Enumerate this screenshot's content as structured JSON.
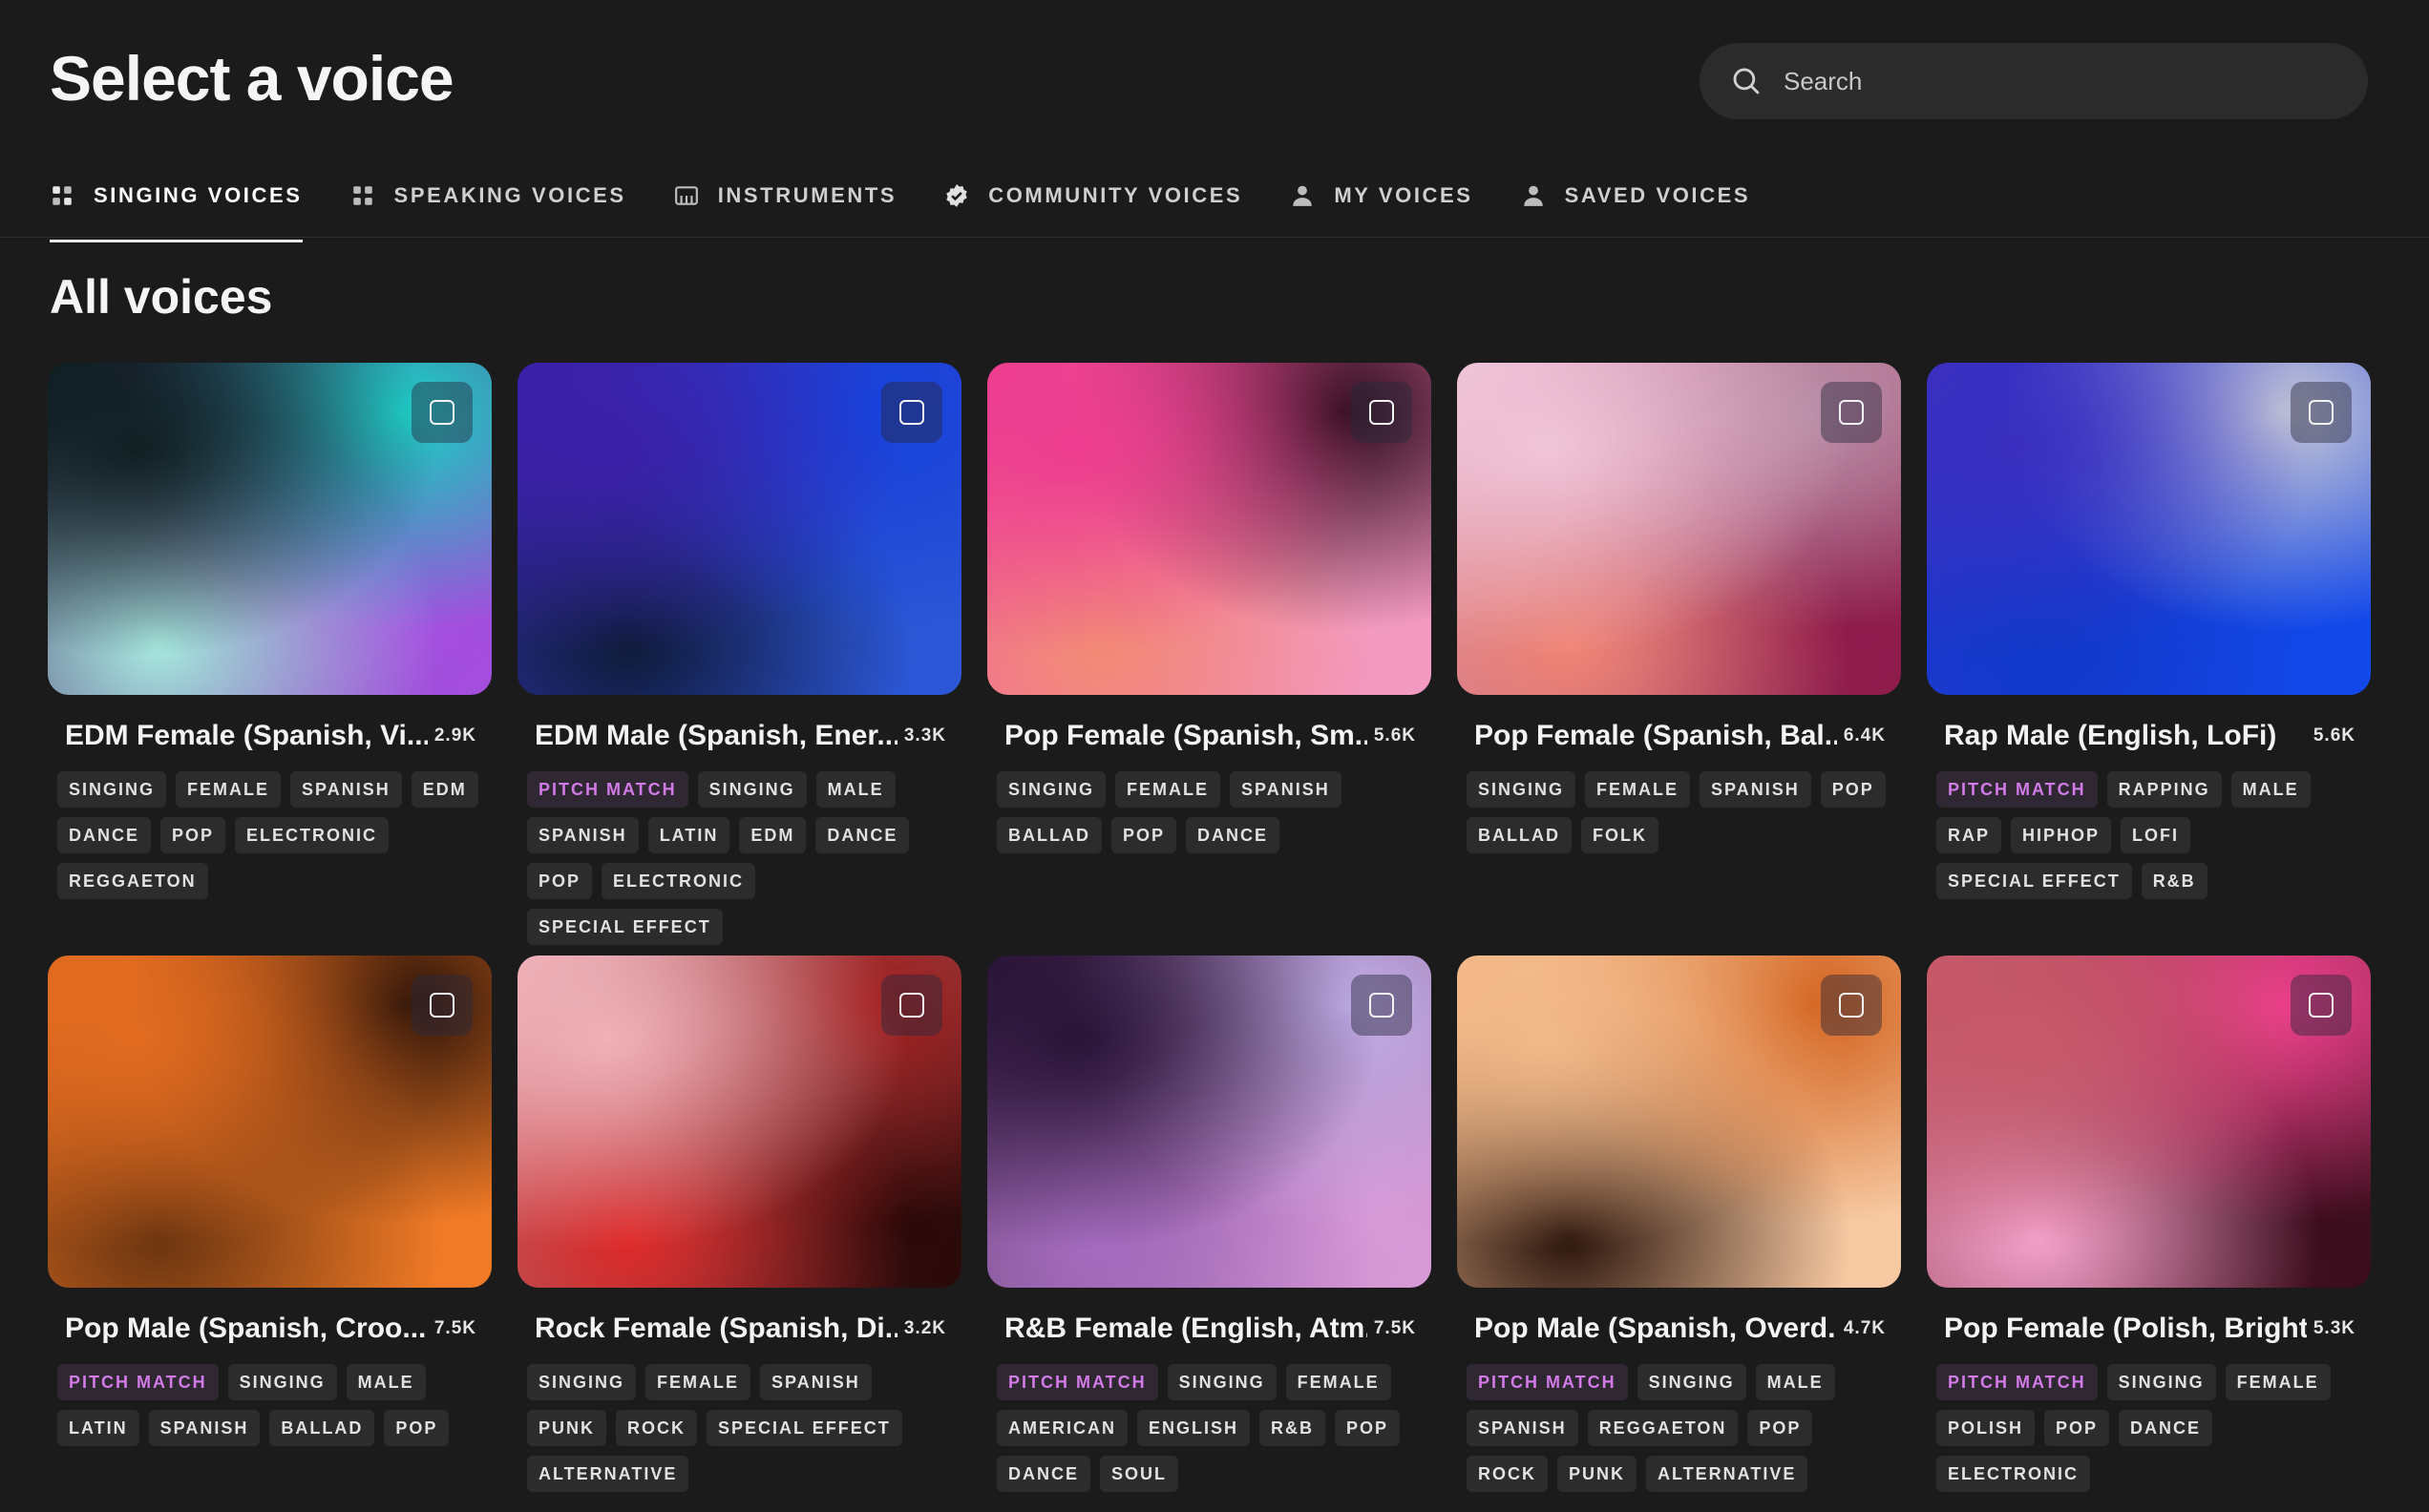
{
  "header": {
    "title": "Select a voice",
    "search_placeholder": "Search"
  },
  "tabs": [
    {
      "label": "SINGING VOICES",
      "icon": "singing-icon",
      "active": true
    },
    {
      "label": "SPEAKING VOICES",
      "icon": "speaking-icon",
      "active": false
    },
    {
      "label": "INSTRUMENTS",
      "icon": "piano-icon",
      "active": false
    },
    {
      "label": "COMMUNITY VOICES",
      "icon": "verified-badge-icon",
      "active": false
    },
    {
      "label": "MY VOICES",
      "icon": "person-icon",
      "active": false
    },
    {
      "label": "SAVED VOICES",
      "icon": "person-icon",
      "active": false
    }
  ],
  "section_title": "All voices",
  "colors": {
    "background": "#1b1b1c",
    "tag_bg": "#2c2c2c",
    "pitch_match": "#d27be8"
  },
  "voices": [
    {
      "name": "EDM Female (Spanish, Vi...",
      "count": "2.9K",
      "tags": [
        "SINGING",
        "FEMALE",
        "SPANISH",
        "EDM",
        "DANCE",
        "POP",
        "ELECTRONIC",
        "REGGAETON"
      ],
      "gradient": [
        "#0f1f22",
        "#1fd6cf",
        "#a7e9df",
        "#a54ee0"
      ]
    },
    {
      "name": "EDM Male (Spanish, Ener...",
      "count": "3.3K",
      "tags": [
        "PITCH MATCH",
        "SINGING",
        "MALE",
        "SPANISH",
        "LATIN",
        "EDM",
        "DANCE",
        "POP",
        "ELECTRONIC",
        "SPECIAL EFFECT"
      ],
      "gradient": [
        "#3b1fa8",
        "#1445e0",
        "#0e1b38",
        "#2b57d6"
      ]
    },
    {
      "name": "Pop Female (Spanish, Sm...",
      "count": "5.6K",
      "tags": [
        "SINGING",
        "FEMALE",
        "SPANISH",
        "BALLAD",
        "POP",
        "DANCE"
      ],
      "gradient": [
        "#ee3d8f",
        "#2a0e1c",
        "#f28b74",
        "#f39bc2"
      ]
    },
    {
      "name": "Pop Female (Spanish, Bal...",
      "count": "6.4K",
      "tags": [
        "SINGING",
        "FEMALE",
        "SPANISH",
        "POP",
        "BALLAD",
        "FOLK"
      ],
      "gradient": [
        "#f0c4d8",
        "#b58aa3",
        "#f08474",
        "#8d1a4a"
      ]
    },
    {
      "name": "Rap Male (English, LoFi)",
      "count": "5.6K",
      "tags": [
        "PITCH MATCH",
        "RAPPING",
        "MALE",
        "RAP",
        "HIPHOP",
        "LOFI",
        "SPECIAL EFFECT",
        "R&B"
      ],
      "gradient": [
        "#3a2fc0",
        "#c9ccd8",
        "#1039c9",
        "#1148ea"
      ]
    },
    {
      "name": "Pop Male (Spanish, Croo...",
      "count": "7.5K",
      "tags": [
        "PITCH MATCH",
        "SINGING",
        "MALE",
        "LATIN",
        "SPANISH",
        "BALLAD",
        "POP"
      ],
      "gradient": [
        "#e06a20",
        "#2a1208",
        "#6a3410",
        "#f07a26"
      ]
    },
    {
      "name": "Rock Female (Spanish, Di...",
      "count": "3.2K",
      "tags": [
        "SINGING",
        "FEMALE",
        "SPANISH",
        "PUNK",
        "ROCK",
        "SPECIAL EFFECT",
        "ALTERNATIVE"
      ],
      "gradient": [
        "#f0b0b8",
        "#a01a1a",
        "#e02a2a",
        "#2a0808"
      ]
    },
    {
      "name": "R&B Female (English, Atm...",
      "count": "7.5K",
      "tags": [
        "PITCH MATCH",
        "SINGING",
        "FEMALE",
        "AMERICAN",
        "ENGLISH",
        "R&B",
        "POP",
        "DANCE",
        "SOUL"
      ],
      "gradient": [
        "#2a1438",
        "#c5b3ec",
        "#a56bc0",
        "#d99ad8"
      ]
    },
    {
      "name": "Pop Male (Spanish, Overd...",
      "count": "4.7K",
      "tags": [
        "PITCH MATCH",
        "SINGING",
        "MALE",
        "SPANISH",
        "REGGAETON",
        "POP",
        "ROCK",
        "PUNK",
        "ALTERNATIVE"
      ],
      "gradient": [
        "#f2b888",
        "#d2601c",
        "#2a140c",
        "#f7c9a2"
      ]
    },
    {
      "name": "Pop Female (Polish, Bright)",
      "count": "5.3K",
      "tags": [
        "PITCH MATCH",
        "SINGING",
        "FEMALE",
        "POLISH",
        "POP",
        "DANCE",
        "ELECTRONIC"
      ],
      "gradient": [
        "#c85a6a",
        "#ee3c8c",
        "#f4a2cc",
        "#3a0c1c"
      ]
    }
  ]
}
